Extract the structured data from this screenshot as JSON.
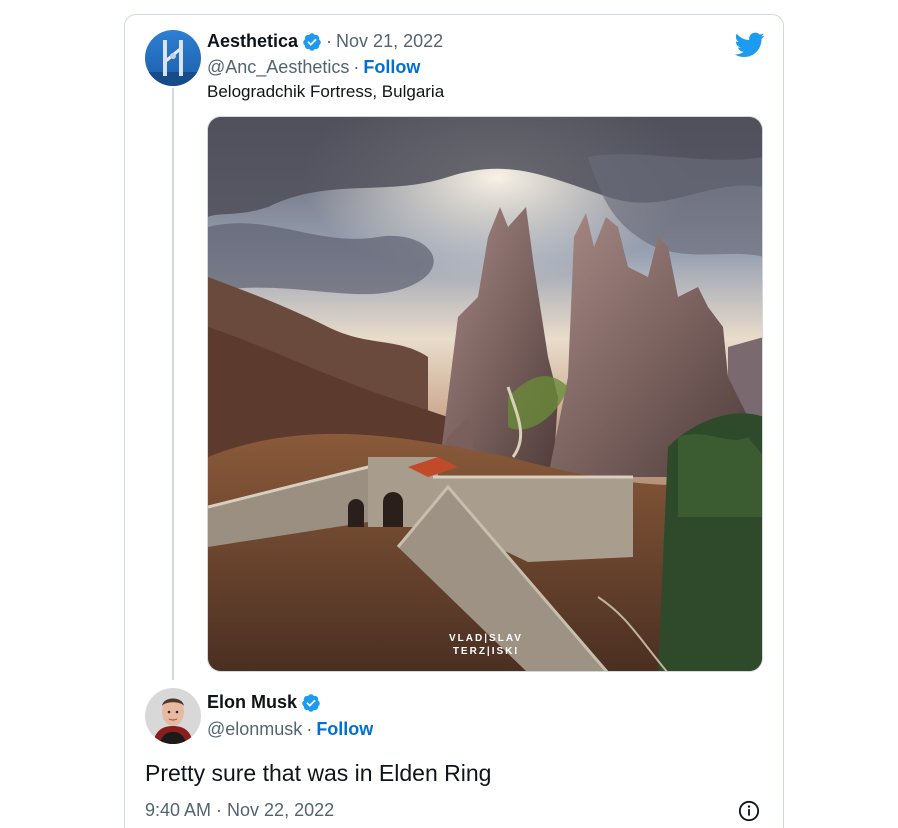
{
  "original_tweet": {
    "author_name": "Aesthetica",
    "date": "Nov 21, 2022",
    "handle": "@Anc_Aesthetics",
    "follow_label": "Follow",
    "text": "Belogradchik Fortress, Bulgaria",
    "photo_watermark_line1": "VLAD|SLAV",
    "photo_watermark_line2": "TERZ|ISKI"
  },
  "reply_tweet": {
    "author_name": "Elon Musk",
    "handle": "@elonmusk",
    "follow_label": "Follow",
    "text": "Pretty sure that was in Elden Ring",
    "timestamp": "9:40 AM · Nov 22, 2022"
  },
  "icons": {
    "brand": "twitter-bird-icon",
    "verified": "verified-badge-icon",
    "info": "info-circle-icon"
  },
  "colors": {
    "verified_blue": "#1d9bf0",
    "follow_blue": "#006fd6",
    "secondary_text": "#536471",
    "border": "#cfd9de"
  }
}
